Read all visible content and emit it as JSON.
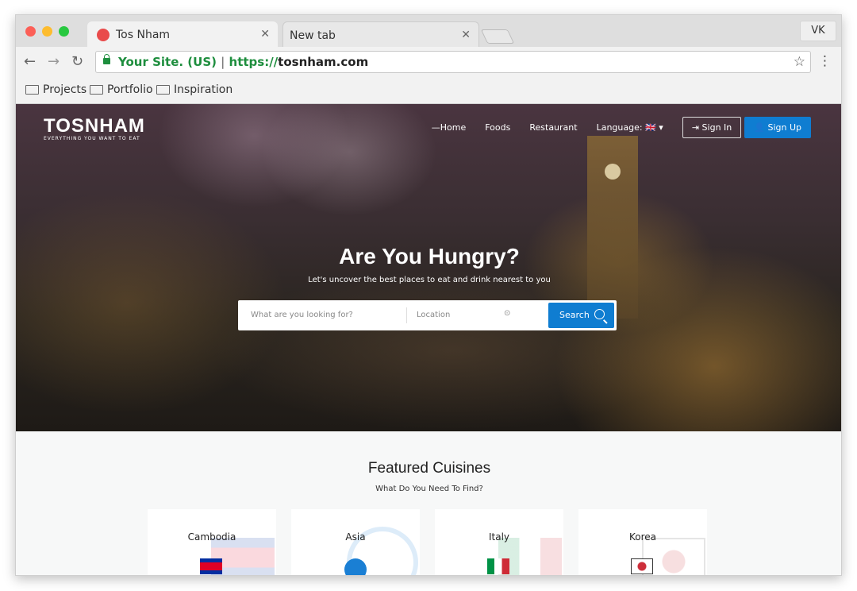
{
  "browser": {
    "tabs": [
      {
        "title": "Tos Nham",
        "active": true
      },
      {
        "title": "New tab",
        "active": false
      }
    ],
    "profile": "VK",
    "address": {
      "site_label": "Your Site. (US)",
      "separator": "|",
      "protocol": "https://",
      "domain": "tosnham.com"
    },
    "bookmarks": [
      "Projects",
      "Portfolio",
      "Inspiration"
    ]
  },
  "site": {
    "logo": "TOSNHAM",
    "tagline": "EVERYTHING YOU WANT TO EAT",
    "nav": [
      "—Home",
      "Foods",
      "Restaurant",
      "Language:"
    ],
    "language_flag": "🇬🇧",
    "sign_in": "Sign In",
    "sign_up": "Sign Up",
    "hero": {
      "title": "Are You Hungry?",
      "subtitle": "Let's uncover the best places to eat and drink nearest to you",
      "search_placeholder": "What are you looking for?",
      "location_placeholder": "Location",
      "search_button": "Search"
    },
    "featured": {
      "title": "Featured Cuisines",
      "subtitle": "What Do You Need To Find?",
      "cuisines": [
        {
          "name": "Cambodia"
        },
        {
          "name": "Asia"
        },
        {
          "name": "Italy"
        },
        {
          "name": "Korea"
        }
      ]
    }
  },
  "colors": {
    "accent": "#0f7dd1",
    "secure": "#1e8e3e"
  }
}
